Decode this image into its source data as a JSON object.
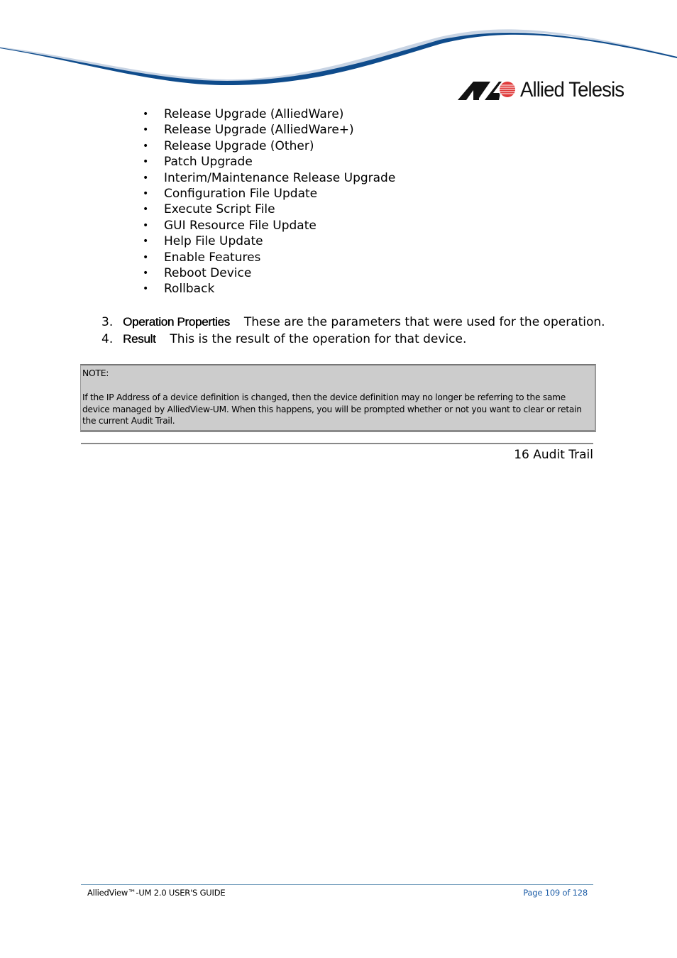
{
  "header": {
    "logo_text": "Allied Telesis",
    "brand_colors": {
      "swoosh_blue": "#0f4c8c",
      "swoosh_light": "#c8d4e4",
      "logo_red": "#e03a3a",
      "logo_black": "#111111"
    }
  },
  "bullets": [
    "Release Upgrade (AlliedWare)",
    "Release Upgrade (AlliedWare+)",
    "Release Upgrade (Other)",
    "Patch Upgrade",
    "Interim/Maintenance Release Upgrade",
    "Configuration File Update",
    "Execute Script File",
    "GUI Resource File Update",
    "Help File Update",
    "Enable Features",
    "Reboot Device",
    "Rollback"
  ],
  "bullet_glyph": "•",
  "numbered_items": [
    {
      "number": "3.",
      "term": "Operation Properties",
      "description": "These are the parameters that were used for the operation."
    },
    {
      "number": "4.",
      "term": "Result",
      "description": "This is the result of the operation for that device."
    }
  ],
  "note": {
    "title": "NOTE:",
    "body": "If the IP Address of a device definition is changed, then the device definition may no longer be referring to the same device managed by AlliedView-UM. When this happens, you will be prompted whether or not you want to clear or retain the current Audit Trail."
  },
  "section_label": "16 Audit Trail",
  "footer": {
    "guide_title": "AlliedView™-UM 2.0 USER'S GUIDE",
    "page_info": "Page 109 of 128"
  }
}
